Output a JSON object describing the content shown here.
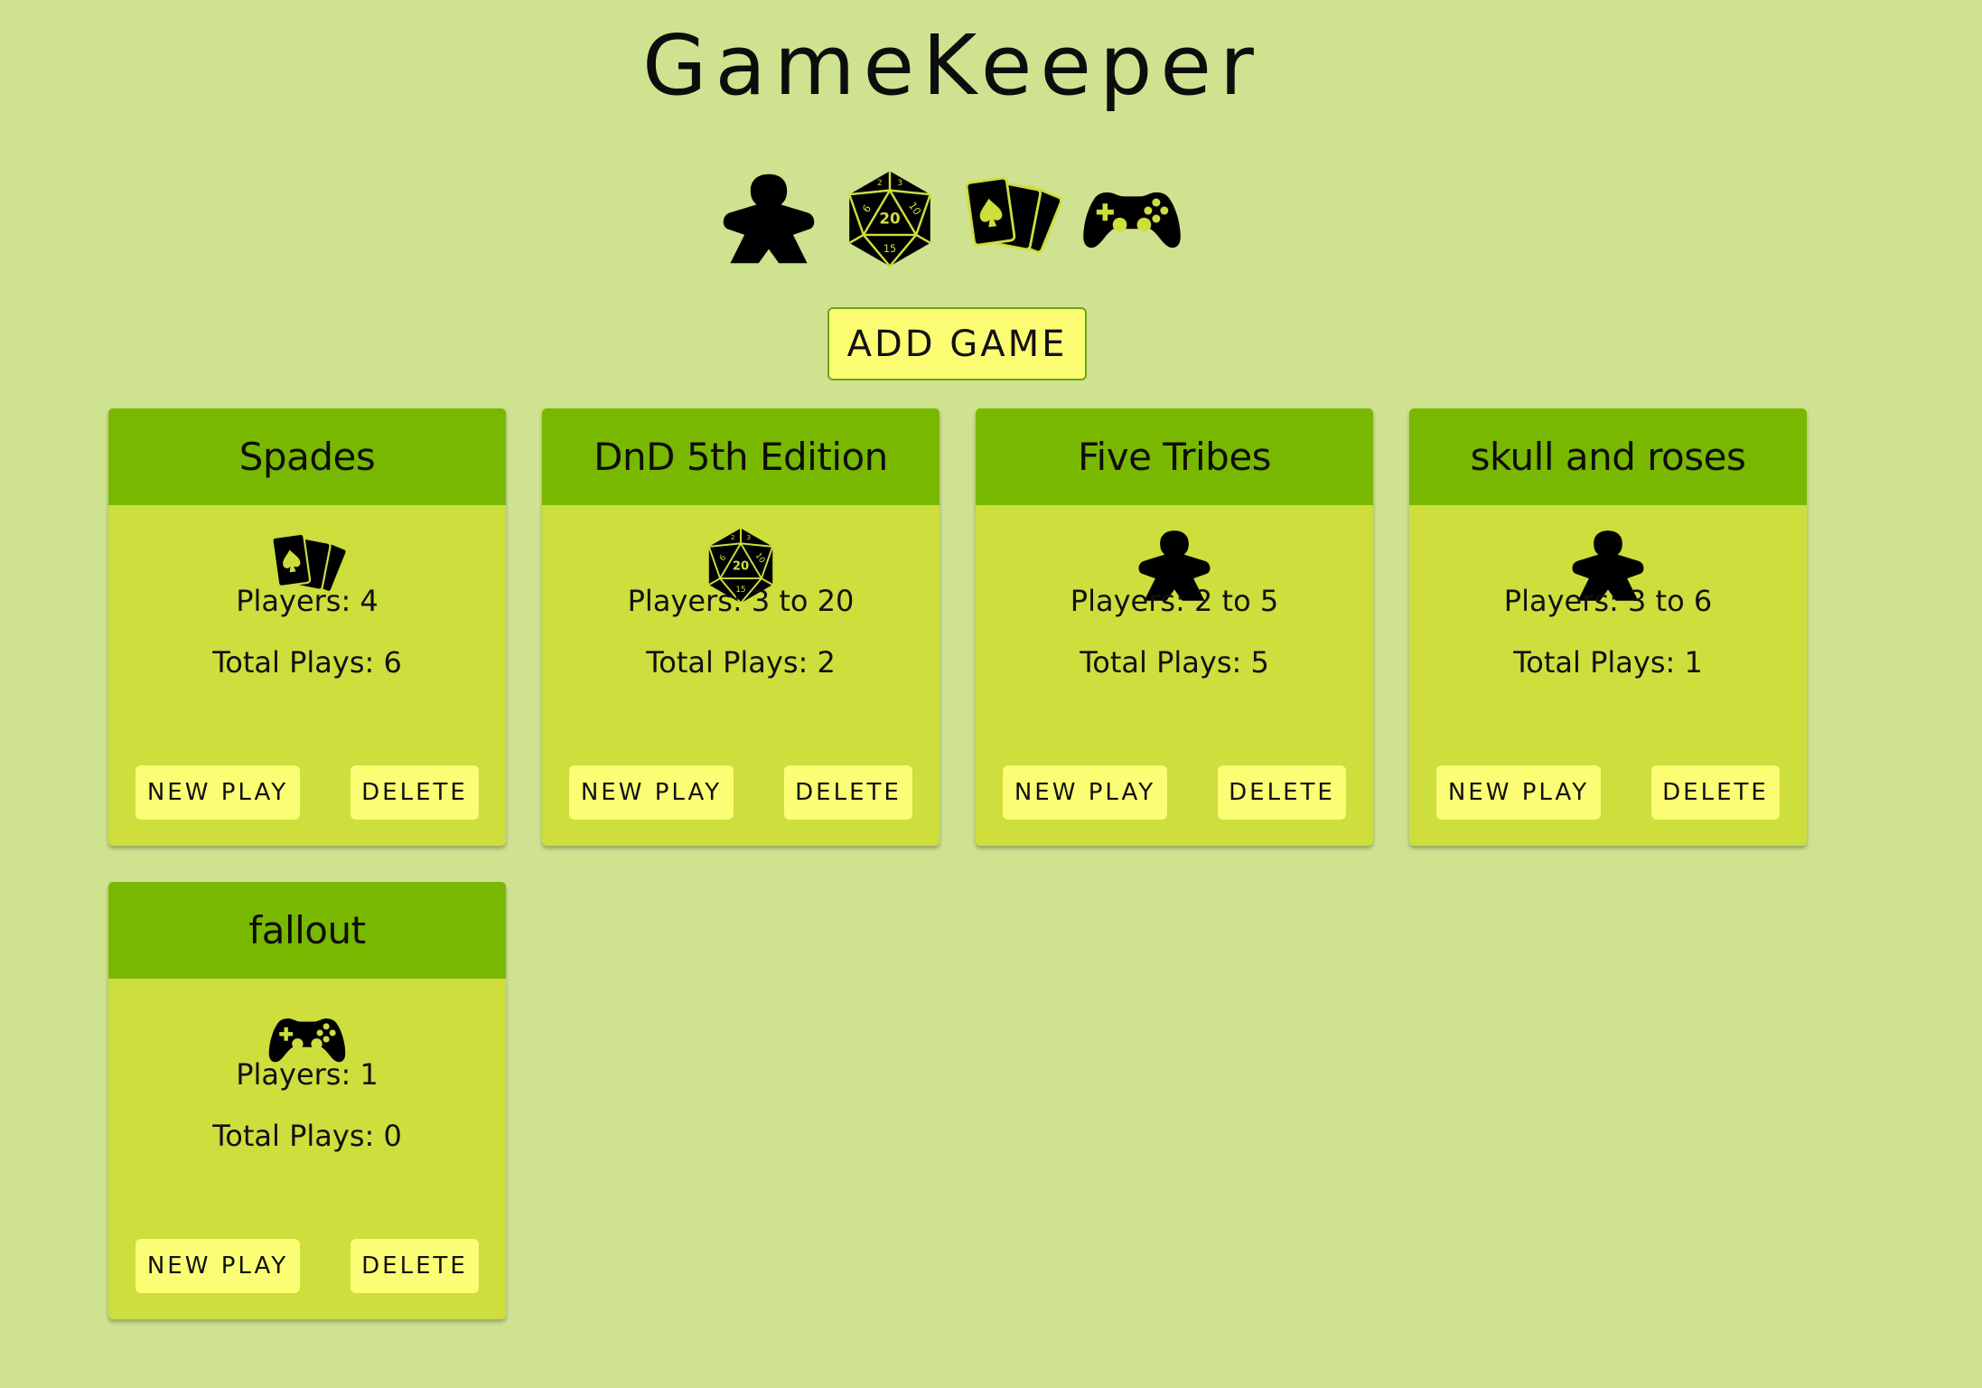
{
  "app": {
    "title": "GameKeeper",
    "add_button_label": "ADD GAME"
  },
  "header_icons": [
    "meeple-icon",
    "d20-icon",
    "cards-icon",
    "gamepad-icon"
  ],
  "games": [
    {
      "name": "Spades",
      "icon": "cards-icon",
      "players_text": "Players: 4",
      "plays_text": "Total Plays: 6",
      "new_play_label": "NEW PLAY",
      "delete_label": "DELETE"
    },
    {
      "name": "DnD 5th Edition",
      "icon": "d20-icon",
      "players_text": "Players: 3 to 20",
      "plays_text": "Total Plays: 2",
      "new_play_label": "NEW PLAY",
      "delete_label": "DELETE"
    },
    {
      "name": "Five Tribes",
      "icon": "meeple-icon",
      "players_text": "Players: 2 to 5",
      "plays_text": "Total Plays: 5",
      "new_play_label": "NEW PLAY",
      "delete_label": "DELETE"
    },
    {
      "name": "skull and roses",
      "icon": "meeple-icon",
      "players_text": "Players: 3 to 6",
      "plays_text": "Total Plays: 1",
      "new_play_label": "NEW PLAY",
      "delete_label": "DELETE"
    },
    {
      "name": "fallout",
      "icon": "gamepad-icon",
      "players_text": "Players: 1",
      "plays_text": "Total Plays: 0",
      "new_play_label": "NEW PLAY",
      "delete_label": "DELETE"
    }
  ],
  "colors": {
    "background": "#cee290",
    "card_body": "#cdde3d",
    "card_header": "#79b800",
    "button": "#fbfd74"
  }
}
